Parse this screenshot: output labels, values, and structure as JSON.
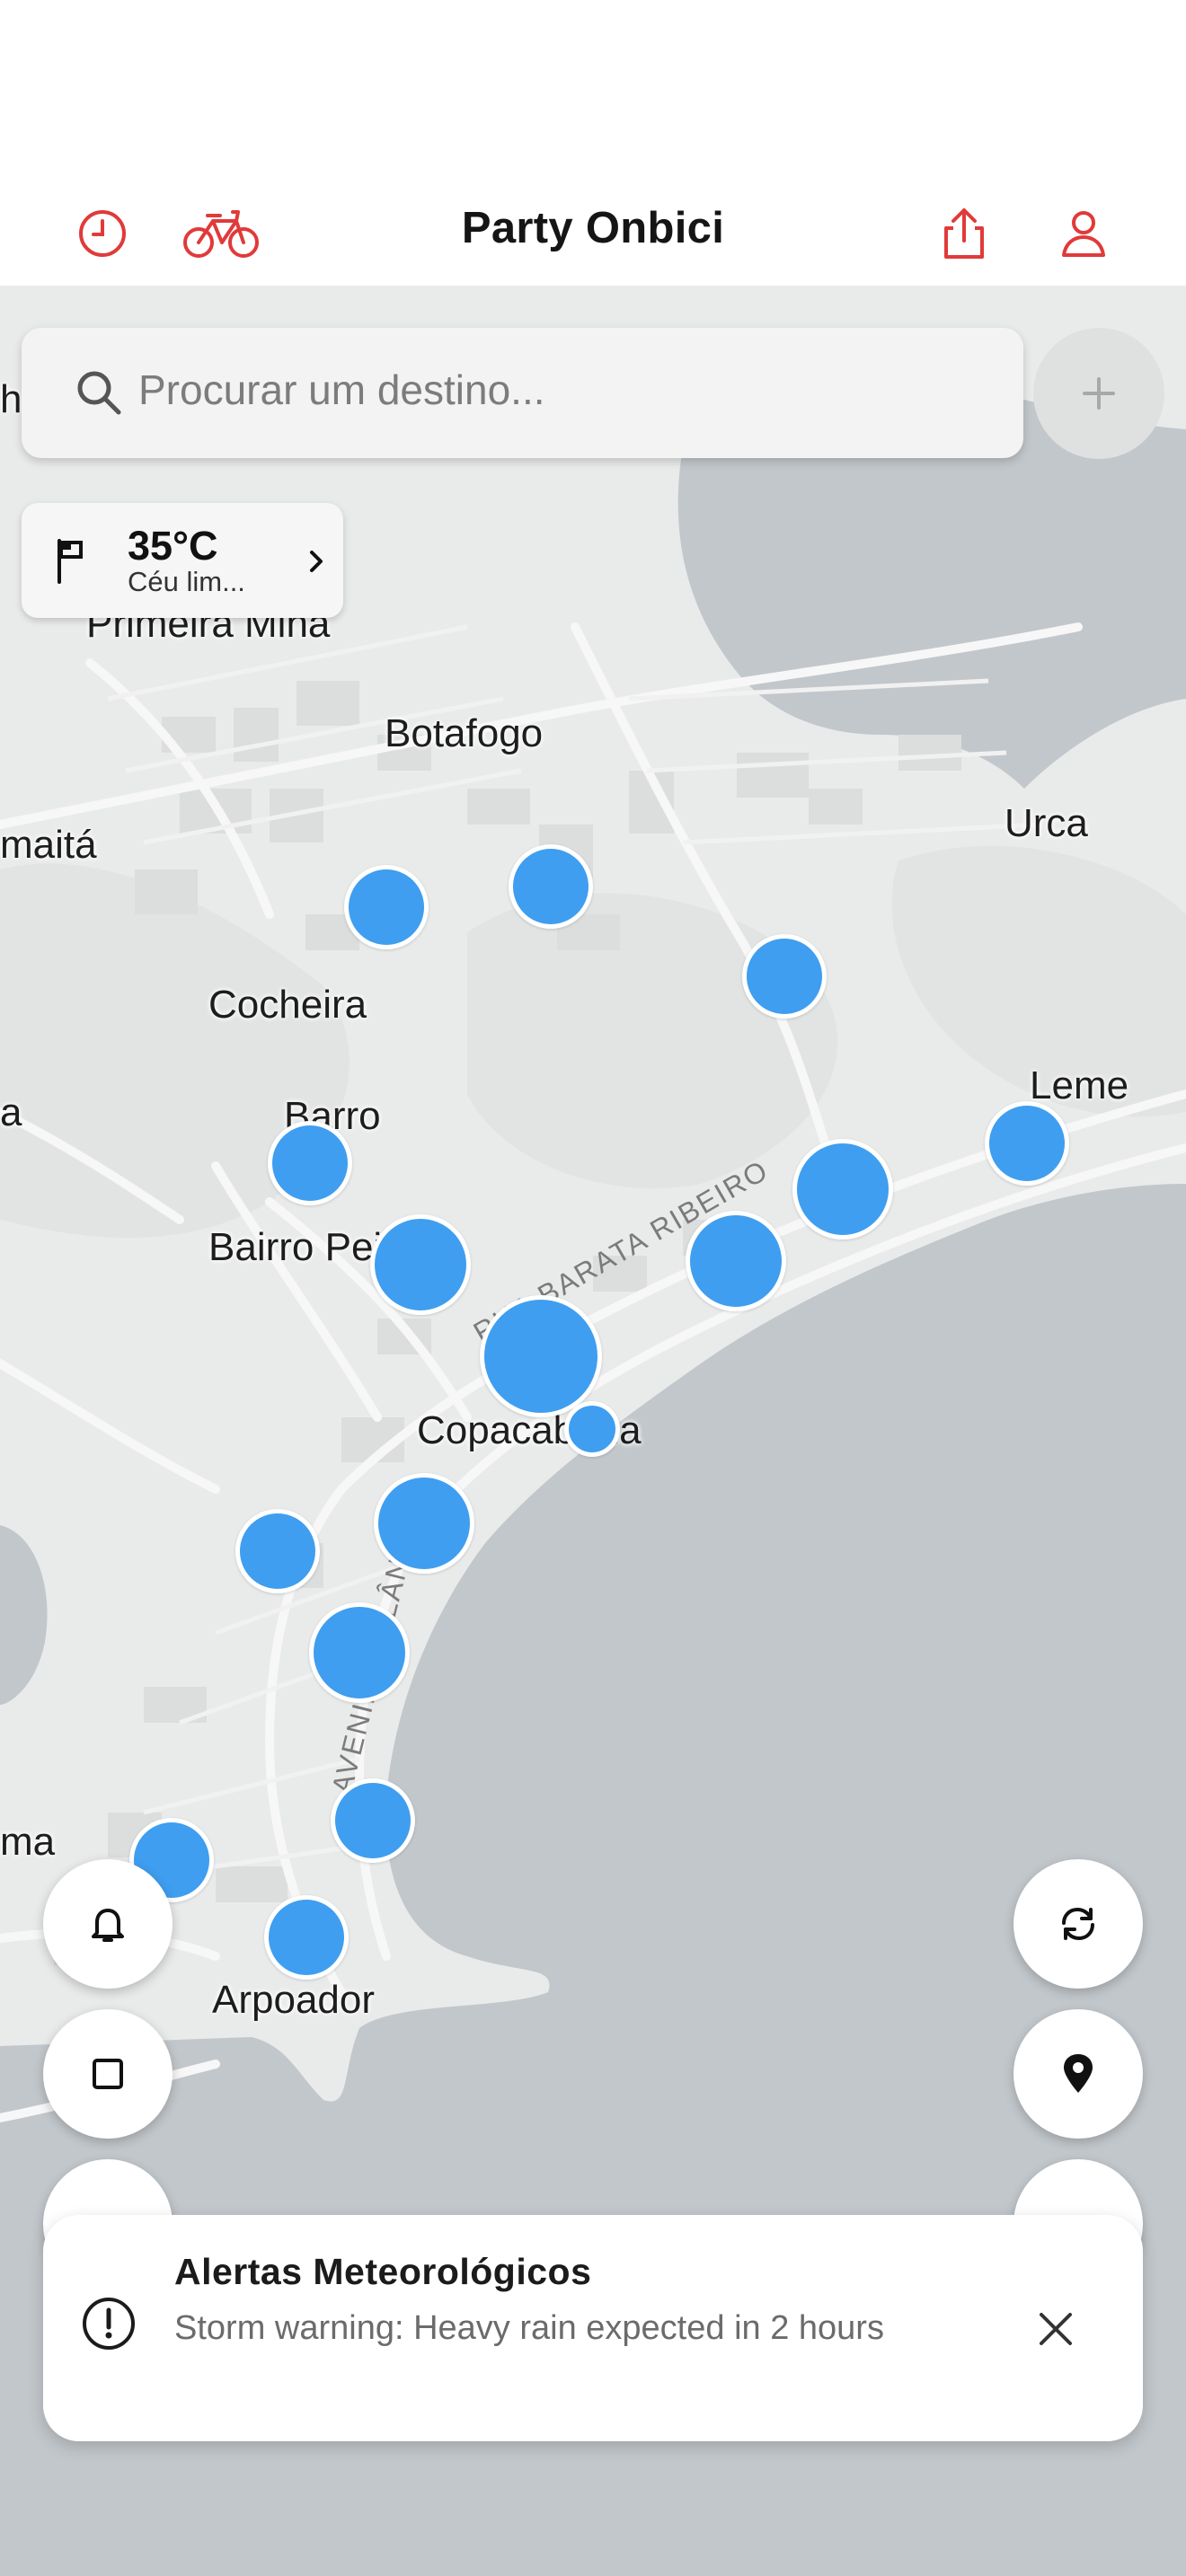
{
  "header": {
    "title": "Party Onbici",
    "history_icon": "clock-icon",
    "bike_icon": "bicycle-icon",
    "share_icon": "share-icon",
    "profile_icon": "user-icon",
    "accent_color": "#e03a3a"
  },
  "search": {
    "placeholder": "Procurar um destino...",
    "icon": "search-icon",
    "add_icon": "plus-icon"
  },
  "weather": {
    "temperature": "35°C",
    "condition": "Céu lim...",
    "icon": "flag-icon",
    "chevron": "chevron-right-icon"
  },
  "map": {
    "neighborhoods": [
      "Primeira Mina",
      "Botafogo",
      "maitá",
      "Urca",
      "Cocheira",
      "Leme",
      "Barro",
      "a",
      "Bairro Peixoto",
      "Copacabana",
      "ma",
      "Arpoador",
      "he"
    ],
    "streets": [
      "RUA BARATA RIBEIRO",
      "AVENIDA ATLÂNTICA"
    ],
    "station_color": "#3f9eef",
    "water_color": "#c2c7cb",
    "land_color": "#e9ebea"
  },
  "controls": {
    "left": [
      "bell-icon",
      "square-icon"
    ],
    "right": [
      "refresh-icon",
      "location-pin-icon"
    ]
  },
  "alert": {
    "title": "Alertas Meteorológicos",
    "message": "Storm warning: Heavy rain expected in 2 hours",
    "icon": "exclamation-circle-icon",
    "close_icon": "close-icon"
  }
}
